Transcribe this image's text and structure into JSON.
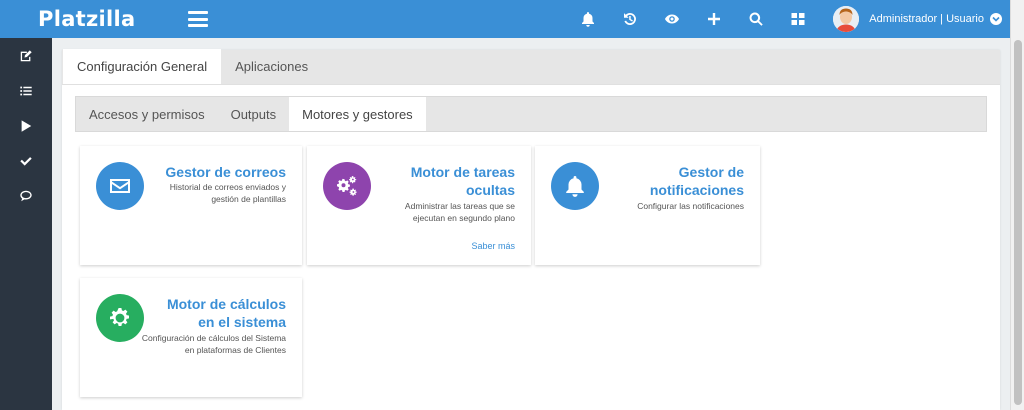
{
  "app": {
    "title": "Platzilla"
  },
  "colors": {
    "accent": "#3a8fd6",
    "sidebar": "#2b3541",
    "purple": "#8e44ad",
    "green": "#27ae60"
  },
  "header": {
    "icons": [
      "bell-icon",
      "history-icon",
      "eye-icon",
      "plus-icon",
      "search-icon",
      "grid-icon"
    ],
    "user_label": "Administrador | Usuario"
  },
  "sidebar": {
    "items": [
      {
        "icon": "edit-icon"
      },
      {
        "icon": "list-icon"
      },
      {
        "icon": "play-icon"
      },
      {
        "icon": "check-icon"
      },
      {
        "icon": "chat-icon"
      }
    ]
  },
  "tabs": {
    "primary": [
      "Configuración General",
      "Aplicaciones"
    ],
    "secondary": [
      "Accesos y permisos",
      "Outputs",
      "Motores y gestores"
    ]
  },
  "cards": [
    {
      "title": "Gestor de correos",
      "description": "Historial de correos enviados y gestión de plantillas",
      "icon": "envelope-icon",
      "color": "#3a8fd6"
    },
    {
      "title": "Motor de tareas ocultas",
      "description": "Administrar las tareas que se ejecutan en segundo plano",
      "link": "Saber más",
      "icon": "gears-icon",
      "color": "#8e44ad"
    },
    {
      "title": "Gestor de notificaciones",
      "description": "Configurar las notificaciones",
      "icon": "bell-icon",
      "color": "#3a8fd6"
    },
    {
      "title": "Motor de cálculos en el sistema",
      "description": "Configuración de cálculos del Sistema en plataformas de Clientes",
      "icon": "gear-icon",
      "color": "#27ae60"
    }
  ]
}
